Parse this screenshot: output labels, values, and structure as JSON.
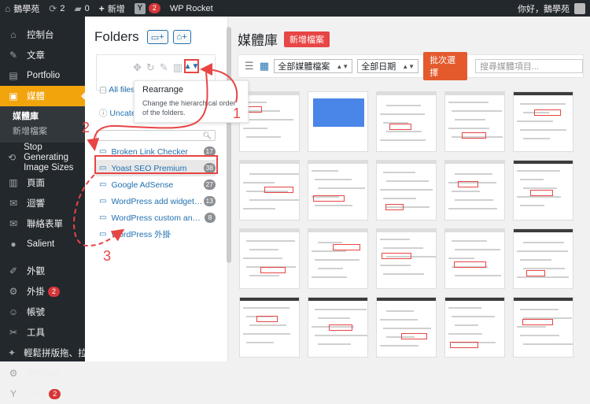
{
  "adminbar": {
    "site_name": "鵝學苑",
    "updates_count": "2",
    "comments_count": "0",
    "new_label": "新增",
    "yoast_count": "2",
    "wp_rocket": "WP Rocket",
    "greeting": "你好，鵝學苑"
  },
  "sidebar": {
    "items": [
      {
        "icon": "dashboard-icon",
        "glyph": "⌂",
        "label": "控制台"
      },
      {
        "icon": "pin-icon",
        "glyph": "✎",
        "label": "文章"
      },
      {
        "icon": "portfolio-icon",
        "glyph": "▤",
        "label": "Portfolio"
      },
      {
        "icon": "media-icon",
        "glyph": "▣",
        "label": "媒體",
        "active": true
      },
      {
        "icon": "stop-icon",
        "glyph": "⟲",
        "label": "Stop Generating Image Sizes"
      },
      {
        "icon": "pages-icon",
        "glyph": "▥",
        "label": "頁面"
      },
      {
        "icon": "comments-icon",
        "glyph": "✉",
        "label": "迴響"
      },
      {
        "icon": "contact-form-icon",
        "glyph": "✉",
        "label": "聯絡表單"
      },
      {
        "icon": "salient-icon",
        "glyph": "●",
        "label": "Salient"
      },
      {
        "icon": "appearance-icon",
        "glyph": "✐",
        "label": "外觀"
      },
      {
        "icon": "plugins-icon",
        "glyph": "⚙",
        "label": "外掛",
        "badge": "2"
      },
      {
        "icon": "users-icon",
        "glyph": "☺",
        "label": "帳號"
      },
      {
        "icon": "tools-icon",
        "glyph": "✂",
        "label": "工具"
      },
      {
        "icon": "drag-drop-icon",
        "glyph": "✦",
        "label": "輕鬆拼版拖、拉、酷！"
      },
      {
        "icon": "settings-icon",
        "glyph": "⚙",
        "label": "Settings"
      },
      {
        "icon": "seo-icon",
        "glyph": "Y",
        "label": "SEO",
        "badge": "2"
      }
    ],
    "submenu": [
      "媒體庫",
      "新增檔案"
    ]
  },
  "folders": {
    "title": "Folders",
    "new_folder_btn": "+",
    "new_subfolder_btn": "+",
    "all_files": "All files",
    "uncategorized": "Uncategorized",
    "tooltip_title": "Rearrange",
    "tooltip_desc": "Change the hierarchical order of the folders.",
    "list": [
      {
        "name": "Broken Link Checker",
        "count": "17"
      },
      {
        "name": "Yoast SEO Premium",
        "count": "38",
        "selected": true
      },
      {
        "name": "Google AdSense",
        "count": "27"
      },
      {
        "name": "WordPress add widget bloo...",
        "count": "13"
      },
      {
        "name": "WordPress custom announc...",
        "count": "8"
      },
      {
        "name": "WordPress 外掛",
        "count": ""
      }
    ]
  },
  "main": {
    "title": "媒體庫",
    "add_new": "新增檔案",
    "filter_type": "全部媒體檔案",
    "filter_date": "全部日期",
    "bulk_select": "批次選擇",
    "search_placeholder": "搜尋媒體項目..."
  },
  "annotations": [
    "1",
    "2",
    "3"
  ],
  "colors": {
    "accent": "#e84545",
    "wp_dark": "#23282d",
    "active_menu": "#f2a40d",
    "link": "#2271b1"
  }
}
